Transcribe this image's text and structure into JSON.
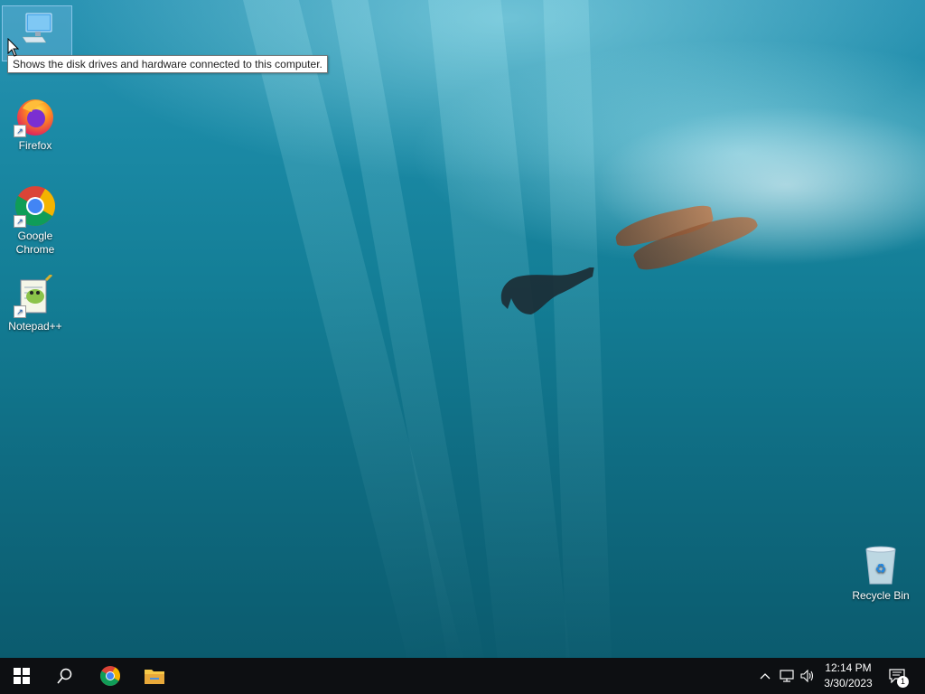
{
  "desktop": {
    "icons": [
      {
        "label": "Firefox"
      },
      {
        "label": "Google Chrome"
      },
      {
        "label": "Notepad++"
      },
      {
        "label": "Recycle Bin"
      }
    ],
    "tooltip": "Shows the disk drives and hardware connected to this computer."
  },
  "taskbar": {
    "clock": {
      "time": "12:14 PM",
      "date": "3/30/2023"
    },
    "notification_count": "1"
  },
  "colors": {
    "taskbar_bg": "#0d0f12",
    "start_icon": "#ffffff"
  }
}
